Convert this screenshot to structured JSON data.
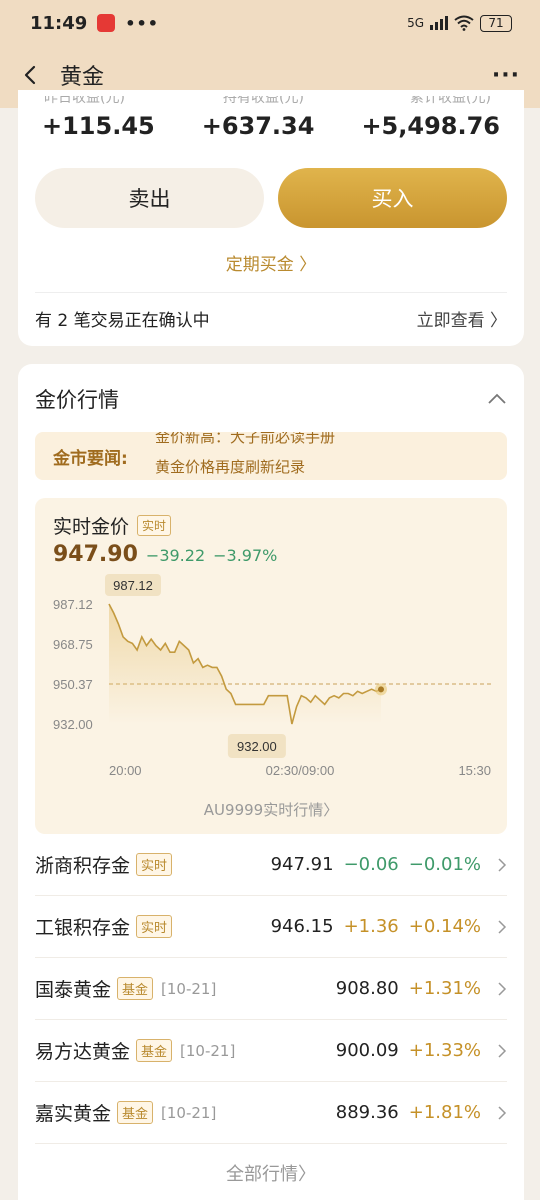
{
  "status": {
    "time": "11:49",
    "network": "5G",
    "battery": "71"
  },
  "nav": {
    "title": "黄金"
  },
  "stats": {
    "labels": [
      "昨日收益(元)",
      "持有收益(元)",
      "累计收益(元)"
    ],
    "values": [
      "+115.45",
      "+637.34",
      "+5,498.76"
    ]
  },
  "actions": {
    "sell": "卖出",
    "buy": "买入",
    "regular": "定期买金 〉",
    "pending": "有 2 笔交易正在确认中",
    "view_now": "立即查看 〉"
  },
  "market": {
    "title": "金价行情",
    "news_label": "金市要闻:",
    "news_items": [
      "金价新高：大子前必读手册",
      "黄金价格再度刷新纪录"
    ]
  },
  "realtime": {
    "title": "实时金价",
    "tag": "实时",
    "price": "947.90",
    "change": "−39.22",
    "change_pct": "−3.97%",
    "au_link": "AU9999实时行情〉"
  },
  "chart_data": {
    "type": "line",
    "y_ticks": [
      "987.12",
      "968.75",
      "950.37",
      "932.00"
    ],
    "ylim": [
      932.0,
      987.12
    ],
    "x_ticks": [
      "20:00",
      "02:30/09:00",
      "15:30"
    ],
    "max_label": "987.12",
    "min_label": "932.00",
    "reference_line": 950.37,
    "series": [
      {
        "values": [
          987.12,
          983,
          978,
          972,
          970,
          969,
          966,
          972,
          968,
          971,
          968,
          966,
          969,
          965,
          965,
          970,
          968,
          966,
          960,
          962,
          958,
          959,
          958,
          958,
          954,
          948,
          946,
          941,
          941,
          941,
          941,
          941,
          941,
          941,
          945,
          945,
          945,
          945,
          945,
          932,
          940,
          945,
          944,
          942,
          945,
          943,
          941,
          944,
          945,
          944,
          946,
          946,
          945,
          947,
          946,
          947,
          948,
          947,
          947.9
        ]
      }
    ]
  },
  "quotes": [
    {
      "name": "浙商积存金",
      "tag": "实时",
      "date": "",
      "price": "947.91",
      "change": "−0.06",
      "pct": "−0.01%",
      "dir": "down"
    },
    {
      "name": "工银积存金",
      "tag": "实时",
      "date": "",
      "price": "946.15",
      "change": "+1.36",
      "pct": "+0.14%",
      "dir": "up"
    },
    {
      "name": "国泰黄金",
      "tag": "基金",
      "date": "[10-21]",
      "price": "908.80",
      "change": "",
      "pct": "+1.31%",
      "dir": "up"
    },
    {
      "name": "易方达黄金",
      "tag": "基金",
      "date": "[10-21]",
      "price": "900.09",
      "change": "",
      "pct": "+1.33%",
      "dir": "up"
    },
    {
      "name": "嘉实黄金",
      "tag": "基金",
      "date": "[10-21]",
      "price": "889.36",
      "change": "",
      "pct": "+1.81%",
      "dir": "up"
    }
  ],
  "all_quotes": "全部行情〉"
}
